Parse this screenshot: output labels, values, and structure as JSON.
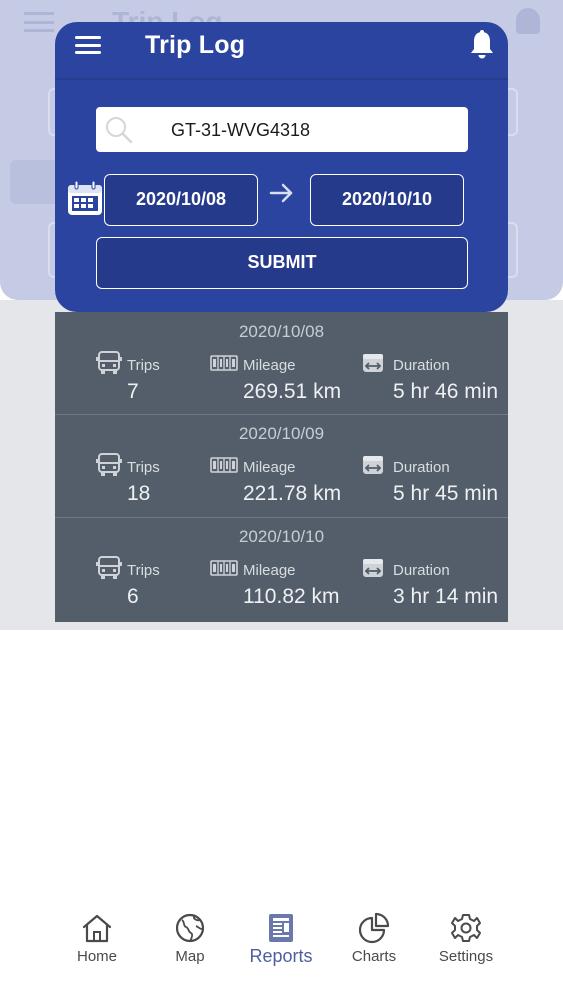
{
  "header": {
    "title": "Trip Log",
    "menu_icon": "menu-icon",
    "bell_icon": "bell-icon"
  },
  "search": {
    "value": "GT-31-WVG4318",
    "icon": "search-icon"
  },
  "date_range": {
    "from": "2020/10/08",
    "to": "2020/10/10",
    "calendar_icon": "calendar-icon",
    "arrow_icon": "arrow-right-icon"
  },
  "submit_label": "SUBMIT",
  "labels": {
    "trips": "Trips",
    "mileage": "Mileage",
    "duration": "Duration"
  },
  "rows": [
    {
      "date": "2020/10/08",
      "trips": "7",
      "mileage": "269.51 km",
      "duration": "5 hr 46 min"
    },
    {
      "date": "2020/10/09",
      "trips": "18",
      "mileage": "221.78 km",
      "duration": "5 hr 45 min"
    },
    {
      "date": "2020/10/10",
      "trips": "6",
      "mileage": "110.82 km",
      "duration": "3 hr 14 min"
    }
  ],
  "nav": {
    "active": "Reports",
    "items": [
      {
        "label": "Home",
        "icon": "home-icon"
      },
      {
        "label": "Map",
        "icon": "globe-icon"
      },
      {
        "label": "Reports",
        "icon": "report-icon"
      },
      {
        "label": "Charts",
        "icon": "pie-chart-icon"
      },
      {
        "label": "Settings",
        "icon": "gear-icon"
      }
    ]
  },
  "colors": {
    "header_blue": "#2b44a0",
    "button_blue": "#263a8c",
    "list_gray": "#535e6a",
    "active_nav": "#4d5e9f"
  }
}
